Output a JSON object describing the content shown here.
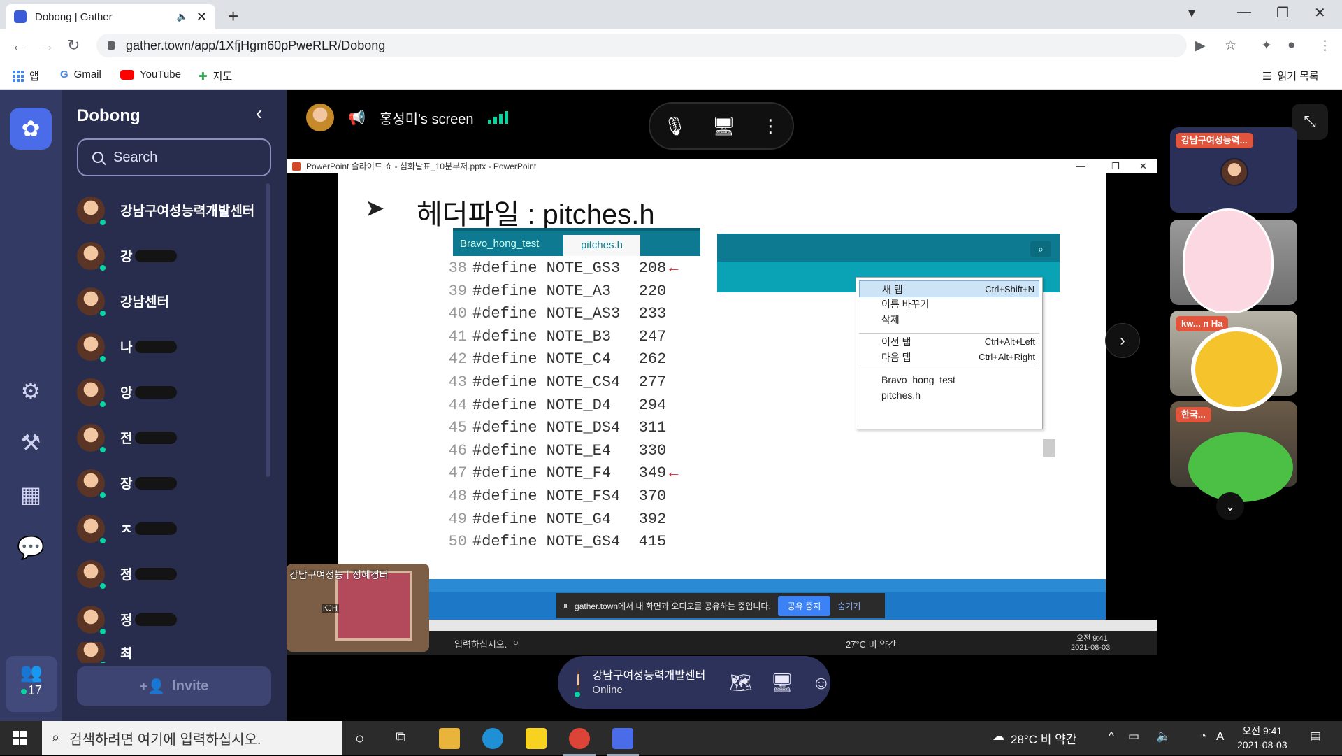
{
  "browser": {
    "tab_title": "Dobong | Gather",
    "url": "gather.town/app/1XfjHgm60pPweRLR/Dobong",
    "bookmarks": [
      "앱",
      "Gmail",
      "YouTube",
      "지도"
    ],
    "reading_list": "읽기 목록"
  },
  "sidebar": {
    "space_name": "Dobong",
    "search_placeholder": "Search",
    "users": [
      {
        "name": "강남구여성능력개발센터"
      },
      {
        "name": "강"
      },
      {
        "name": "강남센터"
      },
      {
        "name": "나"
      },
      {
        "name": "앙"
      },
      {
        "name": "전"
      },
      {
        "name": "장"
      },
      {
        "name": "ㅈ"
      },
      {
        "name": "정"
      },
      {
        "name": "정"
      },
      {
        "name": "최"
      }
    ],
    "invite_label": "Invite",
    "online_count": "17"
  },
  "stage": {
    "presenter": "홍성미's screen",
    "ppt_window_title": "PowerPoint 슬라이드 쇼 - 심화발표_10분부저.pptx - PowerPoint",
    "slide_heading": "헤더파일 : pitches.h",
    "tabs": [
      "Bravo_hong_test",
      "pitches.h"
    ],
    "code_lines": [
      {
        "n": "38",
        "text": "#define NOTE_GS3  208",
        "arrow": "←"
      },
      {
        "n": "39",
        "text": "#define NOTE_A3   220",
        "arrow": ""
      },
      {
        "n": "40",
        "text": "#define NOTE_AS3  233",
        "arrow": ""
      },
      {
        "n": "41",
        "text": "#define NOTE_B3   247",
        "arrow": ""
      },
      {
        "n": "42",
        "text": "#define NOTE_C4   262",
        "arrow": ""
      },
      {
        "n": "43",
        "text": "#define NOTE_CS4  277",
        "arrow": ""
      },
      {
        "n": "44",
        "text": "#define NOTE_D4   294",
        "arrow": ""
      },
      {
        "n": "45",
        "text": "#define NOTE_DS4  311",
        "arrow": ""
      },
      {
        "n": "46",
        "text": "#define NOTE_E4   330",
        "arrow": ""
      },
      {
        "n": "47",
        "text": "#define NOTE_F4   349",
        "arrow": "←"
      },
      {
        "n": "48",
        "text": "#define NOTE_FS4  370",
        "arrow": ""
      },
      {
        "n": "49",
        "text": "#define NOTE_G4   392",
        "arrow": ""
      },
      {
        "n": "50",
        "text": "#define NOTE_GS4  415",
        "arrow": ""
      }
    ],
    "context_menu": [
      {
        "label": "새 탭",
        "shortcut": "Ctrl+Shift+N"
      },
      {
        "label": "이름 바꾸기",
        "shortcut": ""
      },
      {
        "label": "삭제",
        "shortcut": ""
      },
      {
        "label": "이전 탭",
        "shortcut": "Ctrl+Alt+Left"
      },
      {
        "label": "다음 탭",
        "shortcut": "Ctrl+Alt+Right"
      },
      {
        "label": "Bravo_hong_test",
        "shortcut": ""
      },
      {
        "label": "pitches.h",
        "shortcut": ""
      }
    ],
    "share_notice": "gather.town에서 내 화면과 오디오를 공유하는 중입니다.",
    "share_stop": "공유 중지",
    "share_hide": "숨기기",
    "inner_search": "입력하십시오.",
    "inner_weather": "27°C 비 약간",
    "inner_time": "오전 9:41",
    "inner_date": "2021-08-03",
    "minimap_label": "강남구여성능ㅣ정혜경터",
    "minimap_tag": "KJH"
  },
  "videos": [
    {
      "label": "강남구여성능력..."
    },
    {
      "label": "kw... n Ha"
    },
    {
      "label": "한국..."
    }
  ],
  "bottom": {
    "name": "강남구여성능력개발센터",
    "status": "Online"
  },
  "taskbar": {
    "search_placeholder": "검색하려면 여기에 입력하십시오.",
    "weather": "28°C 비 약간",
    "ime": "A",
    "time": "오전 9:41",
    "date": "2021-08-03"
  },
  "colors": {
    "rail": "#333a64",
    "panel": "#282d4e",
    "accent_green": "#06d6a0",
    "brand_blue": "#4a6ce8",
    "label_red": "#e2553d"
  }
}
